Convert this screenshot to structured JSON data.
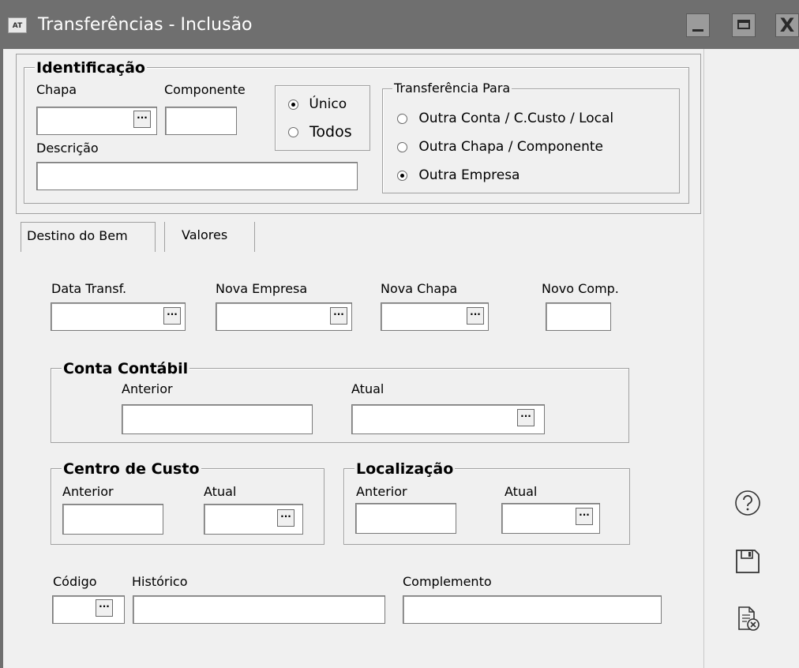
{
  "window": {
    "title": "Transferências - Inclusão",
    "app_icon_text": "AT",
    "close_glyph": "X"
  },
  "identificacao": {
    "title": "Identificação",
    "chapa_label": "Chapa",
    "chapa_value": "",
    "componente_label": "Componente",
    "componente_value": "",
    "descricao_label": "Descrição",
    "descricao_value": "",
    "scope_options": [
      {
        "label": "Único",
        "checked": true
      },
      {
        "label": "Todos",
        "checked": false
      }
    ]
  },
  "transferencia_para": {
    "title": "Transferência Para",
    "options": [
      {
        "label": "Outra Conta / C.Custo / Local",
        "checked": false
      },
      {
        "label": "Outra Chapa / Componente",
        "checked": false
      },
      {
        "label": "Outra Empresa",
        "checked": true
      }
    ]
  },
  "tabs": {
    "destino": "Destino do Bem",
    "valores": "Valores",
    "active": "destino"
  },
  "destino": {
    "data_transf_label": "Data Transf.",
    "nova_empresa_label": "Nova Empresa",
    "nova_chapa_label": "Nova Chapa",
    "novo_comp_label": "Novo Comp.",
    "conta_contabil": {
      "title": "Conta Contábil",
      "anterior": "Anterior",
      "atual": "Atual"
    },
    "centro_custo": {
      "title": "Centro de Custo",
      "anterior": "Anterior",
      "atual": "Atual"
    },
    "localizacao": {
      "title": "Localização",
      "anterior": "Anterior",
      "atual": "Atual"
    },
    "codigo_label": "Código",
    "historico_label": "Histórico",
    "complemento_label": "Complemento"
  },
  "ellipsis": "···",
  "side_icons": [
    "help-icon",
    "save-icon",
    "cancel-document-icon"
  ]
}
